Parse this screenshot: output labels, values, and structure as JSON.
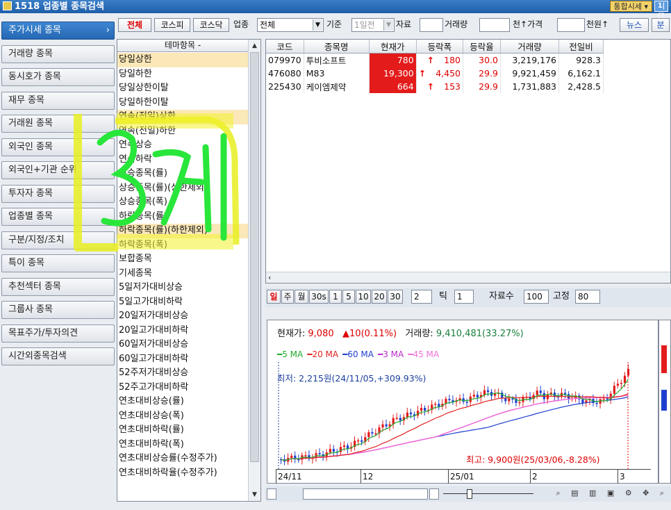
{
  "window": {
    "title": "1518 업종별 종목검색",
    "buttons": {
      "integrated": "통합시세 ▾",
      "extra": "1|□"
    }
  },
  "sidebar": {
    "items": [
      {
        "label": "주가시세 종목",
        "active": true
      },
      {
        "label": "거래량 종목"
      },
      {
        "label": "동시호가 종목"
      },
      {
        "label": "재무 종목"
      },
      {
        "label": "거래원 종목"
      },
      {
        "label": "외국인 종목"
      },
      {
        "label": "외국인+기관 순위"
      },
      {
        "label": "투자자 종목"
      },
      {
        "label": "업종별 종목"
      },
      {
        "label": "구분/지정/조치"
      },
      {
        "label": "특이 종목"
      },
      {
        "label": "추천섹터 종목"
      },
      {
        "label": "그룹사 종목"
      },
      {
        "label": "목표주가/투자의견"
      },
      {
        "label": "시간외종목검색"
      }
    ]
  },
  "filters": {
    "market_all": "전체",
    "kospi": "코스피",
    "kosdaq": "코스닥",
    "sector_label": "업종",
    "sector_value": "전체",
    "basis_label": "기준",
    "basis_value": "1일전",
    "data_label": "자료",
    "volume_label": "거래량",
    "volume_unit": "천↑가격",
    "price_unit": "천원↑",
    "news": "뉴스",
    "analysis": "분"
  },
  "theme_panel": {
    "header": "테마항목 -",
    "items": [
      "당일상한",
      "당일하한",
      "당일상한이탈",
      "당일하한이탈",
      "연속(전일)상한",
      "연속(전일)하한",
      "연속상승",
      "연속하락",
      "상승종목(률)",
      "상승종목(률)(상한제외)",
      "상승종목(폭)",
      "하락종목(률)",
      "하락종목(률)(하한제외)",
      "하락종목(폭)",
      "보합종목",
      "기세종목",
      "5일저가대비상승",
      "5일고가대비하락",
      "20일저가대비상승",
      "20일고가대비하락",
      "60일저가대비상승",
      "60일고가대비하락",
      "52주저가대비상승",
      "52주고가대비하락",
      "연초대비상승(률)",
      "연초대비상승(폭)",
      "연초대비하락(률)",
      "연초대비하락(폭)",
      "연초대비상승률(수정주가)",
      "연초대비하락율(수정주가)"
    ],
    "selected_index": 0,
    "highlighted": [
      4,
      12
    ]
  },
  "table": {
    "headers": [
      "코드",
      "종목명",
      "현재가",
      "등락폭",
      "등락율",
      "거래량",
      "전일비"
    ],
    "rows": [
      {
        "code": "079970",
        "name": "투비소프트",
        "price": "780",
        "change": "180",
        "rate": "30.0",
        "volume": "3,219,176",
        "prev": "928.3"
      },
      {
        "code": "476080",
        "name": "M83",
        "price": "19,300",
        "change": "4,450",
        "rate": "29.9",
        "volume": "9,921,459",
        "prev": "6,162.1"
      },
      {
        "code": "225430",
        "name": "케이엠제약",
        "price": "664",
        "change": "153",
        "rate": "29.9",
        "volume": "1,731,883",
        "prev": "2,428.5"
      }
    ]
  },
  "chart_toolbar": {
    "periods": [
      "일",
      "주",
      "월",
      "30s",
      "1",
      "5",
      "10",
      "20",
      "30"
    ],
    "period_input": "2",
    "tick_label": "틱",
    "tick_value": "1",
    "count_label": "자료수",
    "count_value": "100",
    "fixed_label": "고정",
    "fixed_value": "80"
  },
  "chart": {
    "price_label": "현재가:",
    "price_value": "9,080",
    "change": "▲10(0.11%)",
    "volume_label": "거래량:",
    "volume_value": "9,410,481(33.27%)",
    "ma": [
      {
        "label": "━5 MA",
        "color": "#1faa2a"
      },
      {
        "label": "━20 MA",
        "color": "#e02020"
      },
      {
        "label": "━60 MA",
        "color": "#1f3fcf"
      },
      {
        "label": "━3 MA",
        "color": "#b82ac8"
      },
      {
        "label": "━45 MA",
        "color": "#ee6fd8"
      }
    ],
    "min_label": "최저: 2,215원(24/11/05,+309.93%)",
    "max_label": "최고: 9,900원(25/03/06,-8.28%)",
    "x_labels": [
      "24/11",
      "12",
      "25/01",
      "2",
      "3"
    ]
  },
  "annotation": {
    "text": "3개"
  }
}
